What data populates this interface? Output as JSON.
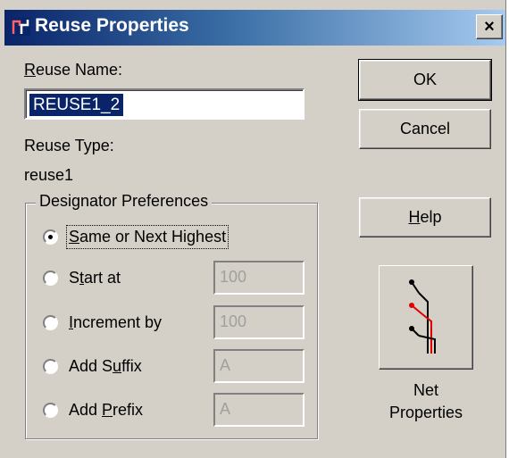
{
  "dialog": {
    "title": "Reuse Properties",
    "close_label": "×"
  },
  "reuse_name": {
    "label_accel": "R",
    "label_rest": "euse Name:",
    "value": "REUSE1_2"
  },
  "reuse_type": {
    "label": "Reuse Type:",
    "value": "reuse1"
  },
  "designator_preferences": {
    "title": "Designator Preferences",
    "options": [
      {
        "pre": "",
        "accel": "S",
        "post": "ame or Next Highest",
        "selected": true,
        "field": null
      },
      {
        "pre": "S",
        "accel": "t",
        "post": "art at",
        "selected": false,
        "field": "100"
      },
      {
        "pre": "",
        "accel": "I",
        "post": "ncrement by",
        "selected": false,
        "field": "100"
      },
      {
        "pre": "Add S",
        "accel": "u",
        "post": "ffix",
        "selected": false,
        "field": "A"
      },
      {
        "pre": "Add ",
        "accel": "P",
        "post": "refix",
        "selected": false,
        "field": "A"
      }
    ]
  },
  "buttons": {
    "ok": "OK",
    "cancel": "Cancel",
    "help_accel": "H",
    "help_rest": "elp"
  },
  "net_properties": {
    "line1": "Net",
    "line2": "Properties"
  },
  "colors": {
    "title_start": "#0a246a",
    "title_end": "#a6caf0",
    "face": "#d4d0c8",
    "selection": "#0a246a",
    "net_red": "#e00000"
  }
}
